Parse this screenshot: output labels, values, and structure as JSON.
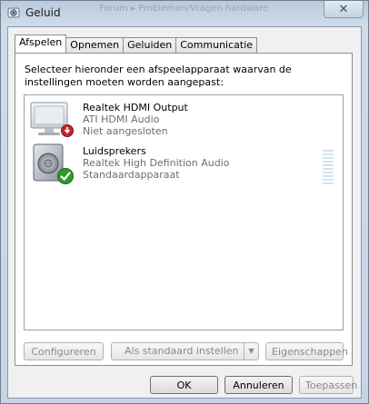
{
  "window": {
    "title": "Geluid",
    "background_tab_text": "Forum ▸ Problemen/Vragen hardware",
    "close_label": "✕"
  },
  "tabs": [
    {
      "label": "Afspelen",
      "active": true
    },
    {
      "label": "Opnemen",
      "active": false
    },
    {
      "label": "Geluiden",
      "active": false
    },
    {
      "label": "Communicatie",
      "active": false
    }
  ],
  "instruction": "Selecteer hieronder een afspeelapparaat waarvan de instellingen moeten worden aangepast:",
  "devices": [
    {
      "name": "Realtek HDMI Output",
      "driver": "ATI HDMI Audio",
      "status": "Niet aangesloten",
      "icon": "monitor-speaker-icon",
      "badge": "unplugged-badge-icon",
      "badge_color": "#c0262d"
    },
    {
      "name": "Luidsprekers",
      "driver": "Realtek High Definition Audio",
      "status": "Standaardapparaat",
      "icon": "speaker-icon",
      "badge": "default-checkmark-icon",
      "badge_color": "#2f9a2a"
    }
  ],
  "buttons": {
    "configure": "Configureren",
    "set_default": "Als standaard instellen",
    "properties": "Eigenschappen",
    "ok": "OK",
    "cancel": "Annuleren",
    "apply": "Toepassen"
  }
}
